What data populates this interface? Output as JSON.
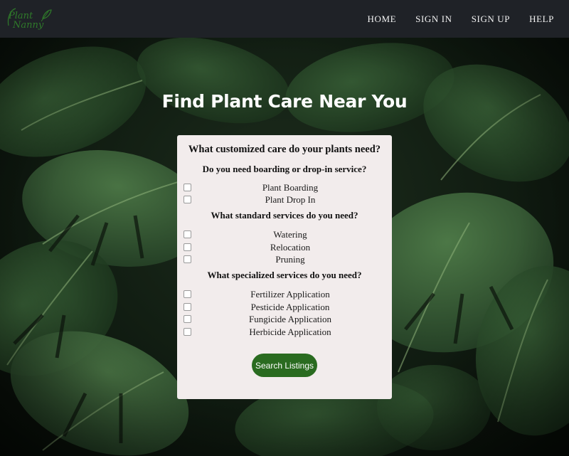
{
  "navbar": {
    "logo_text": "Plant Nanny",
    "links": [
      "HOME",
      "SIGN IN",
      "SIGN UP",
      "HELP"
    ]
  },
  "hero": {
    "title": "Find Plant Care Near You"
  },
  "form": {
    "title": "What customized care do your plants need?",
    "sections": [
      {
        "question": "Do you need boarding or drop-in service?",
        "options": [
          "Plant Boarding",
          "Plant Drop In"
        ]
      },
      {
        "question": "What standard services do you need?",
        "options": [
          "Watering",
          "Relocation",
          "Pruning"
        ]
      },
      {
        "question": "What specialized services do you need?",
        "options": [
          "Fertilizer Application",
          "Pesticide Application",
          "Fungicide Application",
          "Herbicide Application"
        ]
      }
    ],
    "submit_label": "Search Listings"
  },
  "colors": {
    "navbar_bg": "#1f2227",
    "card_bg": "#f2ecec",
    "button_bg": "#2a6b20",
    "logo_green": "#2f7a2a"
  }
}
